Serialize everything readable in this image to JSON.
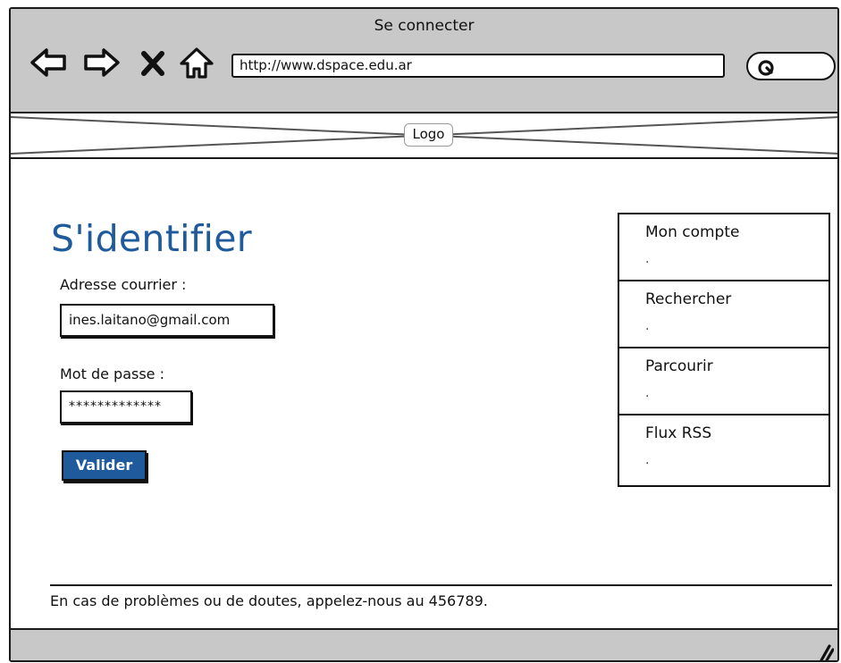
{
  "window": {
    "title": "Se connecter"
  },
  "browser": {
    "url": "http://www.dspace.edu.ar",
    "icons": [
      "back-arrow-icon",
      "forward-arrow-icon",
      "close-x-icon",
      "home-icon",
      "search-icon"
    ]
  },
  "header": {
    "logo_label": "Logo"
  },
  "login": {
    "title": "S'identifier",
    "email_label": "Adresse courrier :",
    "email_value": "ines.laitano@gmail.com",
    "password_label": "Mot de passe :",
    "password_value": "*************",
    "submit_label": "Valider"
  },
  "menu": {
    "items": [
      {
        "label": "Mon compte",
        "dot": "."
      },
      {
        "label": "Rechercher",
        "dot": "."
      },
      {
        "label": "Parcourir",
        "dot": "."
      },
      {
        "label": "Flux RSS",
        "dot": "."
      }
    ]
  },
  "footer": {
    "text": "En cas de problèmes ou de doutes, appelez-nous au 456789."
  },
  "colors": {
    "accent": "#1f5a9c",
    "chrome": "#c8c8c8",
    "ink": "#111111"
  }
}
